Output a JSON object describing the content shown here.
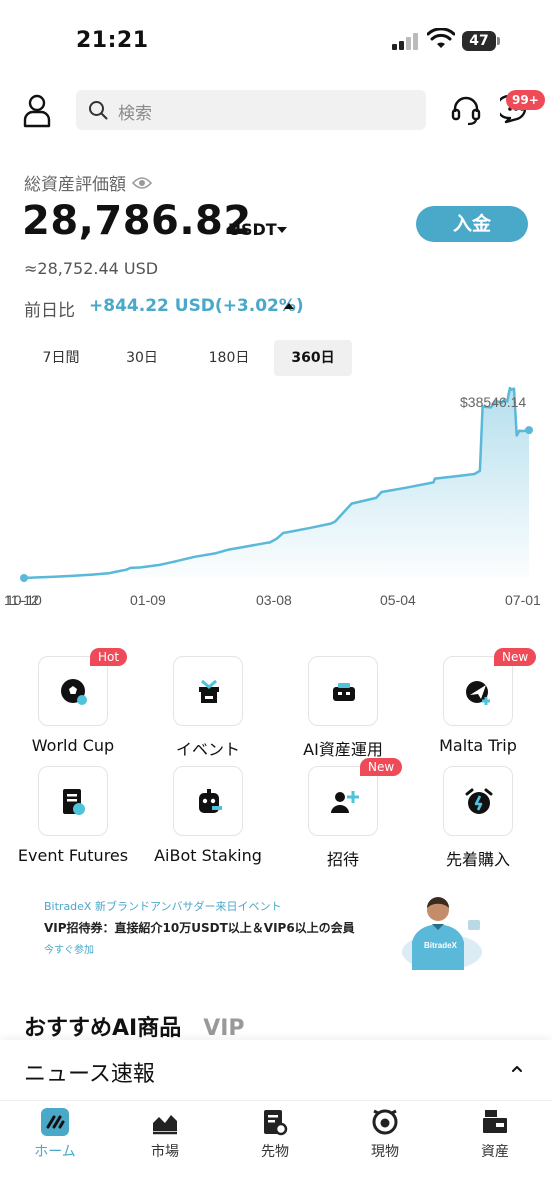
{
  "status_bar": {
    "time": "21:21",
    "battery": "47"
  },
  "header": {
    "search_placeholder": "検索",
    "badge": "99+"
  },
  "assets": {
    "label": "総資産評価額",
    "amount": "28,786.82",
    "currency": "USDT",
    "usd_equiv": "≈28,752.44 USD",
    "deposit_label": "入金",
    "change_label": "前日比",
    "change_value": "+844.22 USD(+3.02%)"
  },
  "period_tabs": [
    {
      "label": "7日間",
      "active": false
    },
    {
      "label": "30日",
      "active": false
    },
    {
      "label": "180日",
      "active": false
    },
    {
      "label": "360日",
      "active": true
    }
  ],
  "chart_data": {
    "type": "area",
    "peak_label": "$38546.14",
    "x_ticks": [
      "11-12",
      "10-10",
      "01-09",
      "03-08",
      "05-04",
      "07-01"
    ],
    "series": [
      {
        "x": 0,
        "y": 0
      },
      {
        "x": 8,
        "y": 110
      },
      {
        "x": 20,
        "y": 230
      },
      {
        "x": 35,
        "y": 420
      },
      {
        "x": 50,
        "y": 690
      },
      {
        "x": 62,
        "y": 960
      },
      {
        "x": 66,
        "y": 1200
      },
      {
        "x": 75,
        "y": 1690
      },
      {
        "x": 78,
        "y": 2050
      },
      {
        "x": 85,
        "y": 2130
      },
      {
        "x": 100,
        "y": 2700
      },
      {
        "x": 110,
        "y": 3300
      },
      {
        "x": 125,
        "y": 4300
      },
      {
        "x": 140,
        "y": 5000
      },
      {
        "x": 150,
        "y": 5760
      },
      {
        "x": 165,
        "y": 6500
      },
      {
        "x": 178,
        "y": 7150
      },
      {
        "x": 180,
        "y": 7200
      },
      {
        "x": 185,
        "y": 7950
      },
      {
        "x": 190,
        "y": 9150
      },
      {
        "x": 192,
        "y": 9240
      },
      {
        "x": 210,
        "y": 10180
      },
      {
        "x": 225,
        "y": 11050
      },
      {
        "x": 228,
        "y": 11460
      },
      {
        "x": 240,
        "y": 15100
      },
      {
        "x": 258,
        "y": 16250
      },
      {
        "x": 262,
        "y": 17450
      },
      {
        "x": 280,
        "y": 18320
      },
      {
        "x": 300,
        "y": 19400
      },
      {
        "x": 301,
        "y": 20170
      },
      {
        "x": 315,
        "y": 20600
      },
      {
        "x": 330,
        "y": 21100
      },
      {
        "x": 334,
        "y": 21740
      },
      {
        "x": 336,
        "y": 34800
      },
      {
        "x": 342,
        "y": 34600
      },
      {
        "x": 346,
        "y": 35900
      },
      {
        "x": 350,
        "y": 35500
      },
      {
        "x": 352,
        "y": 36200
      },
      {
        "x": 354,
        "y": 35800
      },
      {
        "x": 356,
        "y": 38546
      },
      {
        "x": 357,
        "y": 38200
      },
      {
        "x": 359,
        "y": 38400
      },
      {
        "x": 361,
        "y": 28900
      },
      {
        "x": 363,
        "y": 29900
      },
      {
        "x": 365,
        "y": 29800
      },
      {
        "x": 370,
        "y": 30000
      }
    ],
    "color": "#5ab8d8"
  },
  "features": [
    {
      "label": "World Cup",
      "icon": "soccer-ball-icon",
      "badge": "Hot"
    },
    {
      "label": "イベント",
      "icon": "gift-icon",
      "badge": ""
    },
    {
      "label": "AI資産運用",
      "icon": "robot-icon",
      "badge": ""
    },
    {
      "label": "Malta Trip",
      "icon": "plane-icon",
      "badge": "New"
    },
    {
      "label": "Event Futures",
      "icon": "document-icon",
      "badge": ""
    },
    {
      "label": "AiBot Staking",
      "icon": "bot-icon",
      "badge": ""
    },
    {
      "label": "招待",
      "icon": "invite-user-icon",
      "badge": "New"
    },
    {
      "label": "先着購入",
      "icon": "alarm-clock-icon",
      "badge": ""
    }
  ],
  "banner": {
    "subtitle": "BitradeX 新ブランドアンバサダー来日イベント",
    "main": "VIP招待券：直接紹介10万USDT以上＆VIP6以上の会員",
    "cta": "今すぐ参加",
    "shirt_text": "BitradeX"
  },
  "recommend": {
    "title": "おすすめAI商品",
    "vip": "VIP"
  },
  "news": {
    "title": "ニュース速報"
  },
  "bottom_nav": [
    {
      "label": "ホーム",
      "icon": "home-icon",
      "active": true
    },
    {
      "label": "市場",
      "icon": "market-icon",
      "active": false
    },
    {
      "label": "先物",
      "icon": "futures-icon",
      "active": false
    },
    {
      "label": "現物",
      "icon": "spot-icon",
      "active": false
    },
    {
      "label": "資産",
      "icon": "wallet-icon",
      "active": false
    }
  ],
  "colors": {
    "accent": "#4aa8c9",
    "badge": "#ef4a57"
  }
}
